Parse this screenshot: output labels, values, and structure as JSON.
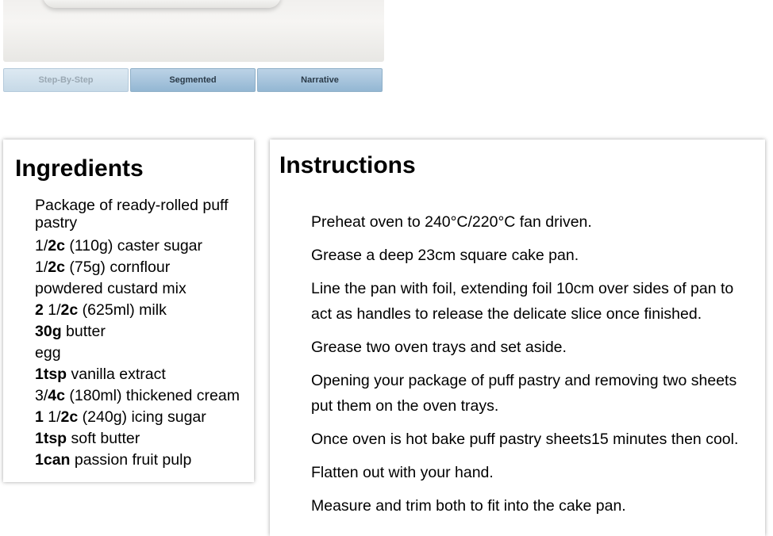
{
  "tabs": [
    {
      "label": "Step-By-Step",
      "state": "active"
    },
    {
      "label": "Segmented",
      "state": "normal"
    },
    {
      "label": "Narrative",
      "state": "normal"
    }
  ],
  "ingredients": {
    "title": "Ingredients",
    "items": [
      {
        "qty": "",
        "rest": "Package of ready-rolled puff pastry"
      },
      {
        "qty_pre": "1/",
        "qty": "2c",
        "rest": " (110g) caster sugar"
      },
      {
        "qty_pre": "1/",
        "qty": "2c",
        "rest": " (75g) cornflour"
      },
      {
        "qty": "",
        "rest": "powdered custard mix"
      },
      {
        "qty": "2",
        "mid": " 1/",
        "qty2": "2c",
        "rest": " (625ml) milk"
      },
      {
        "qty": "30g",
        "rest": " butter"
      },
      {
        "qty": "",
        "rest": "egg"
      },
      {
        "qty": "1tsp",
        "rest": " vanilla extract"
      },
      {
        "qty_pre": "3/",
        "qty": "4c",
        "rest": " (180ml) thickened cream"
      },
      {
        "qty": "1",
        "mid": " 1/",
        "qty2": "2c",
        "rest": " (240g) icing sugar"
      },
      {
        "qty": "1tsp",
        "rest": " soft butter"
      },
      {
        "qty": "1can",
        "rest": " passion fruit pulp"
      }
    ]
  },
  "instructions": {
    "title": "Instructions",
    "steps": [
      "Preheat oven to 240°C/220°C fan driven.",
      "Grease a deep 23cm square cake pan.",
      "Line the pan with foil, extending foil 10cm over sides of pan to act as handles to release the delicate slice once finished.",
      "Grease two oven trays and set aside.",
      "Opening your package of puff pastry and removing two sheets put them on the oven trays.",
      "Once oven is hot bake puff pastry sheets15 minutes then cool.",
      "Flatten out with your hand.",
      "Measure and trim both to fit into the cake pan."
    ]
  }
}
